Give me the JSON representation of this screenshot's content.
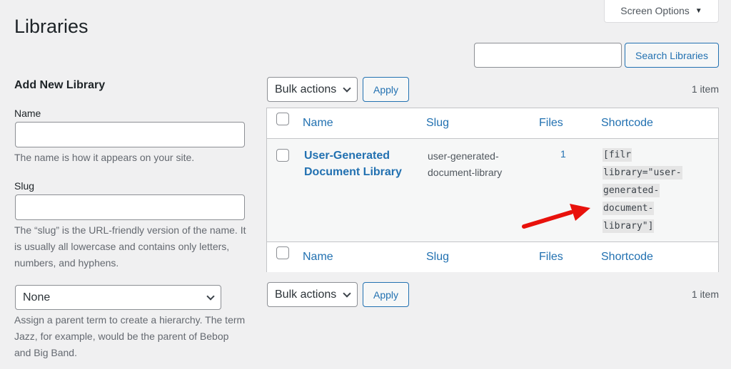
{
  "page": {
    "title": "Libraries",
    "screen_options_label": "Screen Options",
    "screen_options_icon": "triangle-down-icon"
  },
  "search": {
    "value": "",
    "placeholder": "",
    "button_label": "Search Libraries"
  },
  "form": {
    "title": "Add New Library",
    "name_label": "Name",
    "name_value": "",
    "name_help": "The name is how it appears on your site.",
    "slug_label": "Slug",
    "slug_value": "",
    "slug_help": "The “slug” is the URL-friendly version of the name. It is usually all lowercase and contains only letters, numbers, and hyphens.",
    "parent_selected": "None",
    "parent_help": "Assign a parent term to create a hierarchy. The term Jazz, for example, would be the parent of Bebop and Big Band."
  },
  "tablenav_top": {
    "bulk_actions_label": "Bulk actions",
    "apply_label": "Apply",
    "item_count": "1 item"
  },
  "tablenav_bottom": {
    "bulk_actions_label": "Bulk actions",
    "apply_label": "Apply",
    "item_count": "1 item"
  },
  "table": {
    "columns": [
      "Name",
      "Slug",
      "Files",
      "Shortcode"
    ],
    "rows": [
      {
        "name": "User-Generated Document Library",
        "slug": "user-generated-document-library",
        "files": "1",
        "shortcode": "[filr library=\"user-generated-document-library\"]"
      }
    ]
  },
  "annotation": {
    "arrow_color": "#e8120c"
  }
}
